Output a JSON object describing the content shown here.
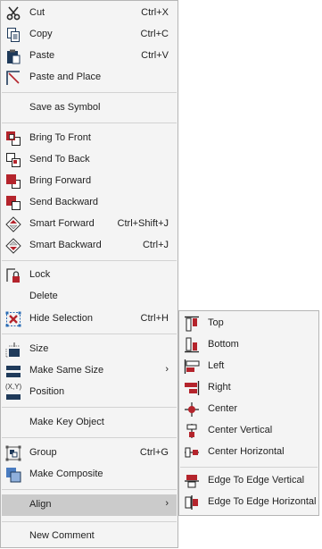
{
  "menu": {
    "cut": {
      "label": "Cut",
      "shortcut": "Ctrl+X",
      "icon": "scissors-icon"
    },
    "copy": {
      "label": "Copy",
      "shortcut": "Ctrl+C",
      "icon": "copy-icon"
    },
    "paste": {
      "label": "Paste",
      "shortcut": "Ctrl+V",
      "icon": "clipboard-icon"
    },
    "paste_place": {
      "label": "Paste and Place",
      "icon": "paste-place-icon"
    },
    "save_symbol": {
      "label": "Save as Symbol"
    },
    "bring_front": {
      "label": "Bring To Front",
      "icon": "bring-to-front-icon"
    },
    "send_back": {
      "label": "Send To Back",
      "icon": "send-to-back-icon"
    },
    "bring_forward": {
      "label": "Bring Forward",
      "icon": "bring-forward-icon"
    },
    "send_backward": {
      "label": "Send Backward",
      "icon": "send-backward-icon"
    },
    "smart_forward": {
      "label": "Smart Forward",
      "shortcut": "Ctrl+Shift+J",
      "icon": "smart-forward-icon"
    },
    "smart_backward": {
      "label": "Smart Backward",
      "shortcut": "Ctrl+J",
      "icon": "smart-backward-icon"
    },
    "lock": {
      "label": "Lock",
      "icon": "lock-icon"
    },
    "delete": {
      "label": "Delete"
    },
    "hide_selection": {
      "label": "Hide Selection",
      "shortcut": "Ctrl+H",
      "icon": "hide-selection-icon"
    },
    "size": {
      "label": "Size",
      "icon": "size-icon"
    },
    "make_same_size": {
      "label": "Make Same Size",
      "arrow": "›",
      "icon": "same-size-icon"
    },
    "position": {
      "label": "Position",
      "icon_text": "(X,Y)",
      "icon": "position-icon"
    },
    "make_key": {
      "label": "Make Key Object"
    },
    "group": {
      "label": "Group",
      "shortcut": "Ctrl+G",
      "icon": "group-icon"
    },
    "make_composite": {
      "label": "Make Composite",
      "icon": "composite-icon"
    },
    "align": {
      "label": "Align",
      "arrow": "›"
    },
    "new_comment": {
      "label": "New Comment"
    }
  },
  "align_submenu": {
    "top": {
      "label": "Top",
      "icon": "align-top-icon"
    },
    "bottom": {
      "label": "Bottom",
      "icon": "align-bottom-icon"
    },
    "left": {
      "label": "Left",
      "icon": "align-left-icon"
    },
    "right": {
      "label": "Right",
      "icon": "align-right-icon"
    },
    "center": {
      "label": "Center",
      "icon": "align-center-icon"
    },
    "center_vertical": {
      "label": "Center Vertical",
      "icon": "center-vertical-icon"
    },
    "center_horizontal": {
      "label": "Center Horizontal",
      "icon": "center-horizontal-icon"
    },
    "edge_vertical": {
      "label": "Edge To Edge Vertical",
      "icon": "edge-to-edge-vertical-icon"
    },
    "edge_horizontal": {
      "label": "Edge To Edge Horizontal",
      "icon": "edge-to-edge-horizontal-icon"
    }
  },
  "colors": {
    "accent": "#b4242c",
    "icon_dark": "#1f3a5a",
    "highlight": "#cbcbcb",
    "background": "#f4f4f4"
  }
}
